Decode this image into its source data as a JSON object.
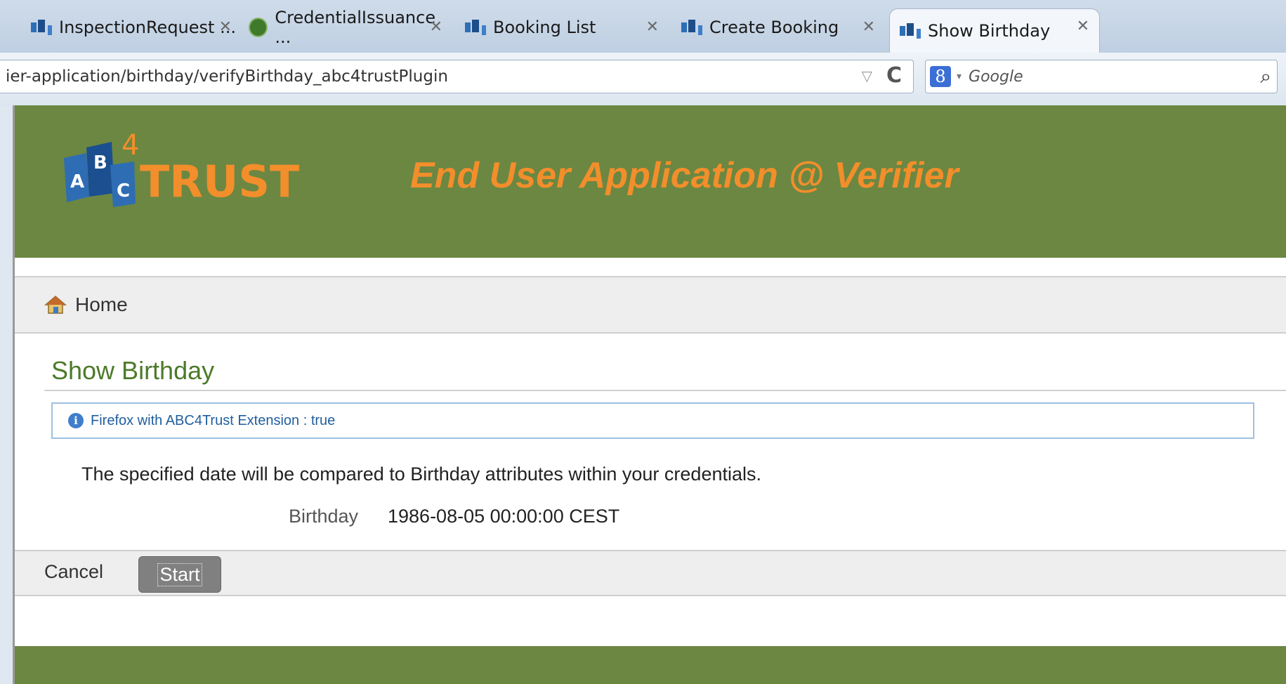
{
  "browser": {
    "tabs": [
      {
        "label": "InspectionRequest ...",
        "icon": "app-icon"
      },
      {
        "label": "CredentialIssuance ...",
        "icon": "green-app-icon"
      },
      {
        "label": "Booking List",
        "icon": "app-icon"
      },
      {
        "label": "Create Booking",
        "icon": "app-icon"
      },
      {
        "label": "Show Birthday",
        "icon": "app-icon",
        "active": true
      }
    ],
    "url": "ier-application/birthday/verifyBirthday_abc4trustPlugin",
    "search_placeholder": "Google",
    "search_engine_letter": "8"
  },
  "header": {
    "logo_text": {
      "a": "A",
      "b": "B",
      "c": "C",
      "four": "4",
      "trust": "TRUST"
    },
    "title": "End User Application @ Verifier",
    "bg_color": "#6b8742",
    "title_color": "#f28e2b"
  },
  "nav": {
    "home_label": "Home"
  },
  "main": {
    "page_title": "Show Birthday",
    "info_text": "Firefox with ABC4Trust Extension : true",
    "description": "The specified date will be compared to Birthday attributes within your credentials.",
    "field_label": "Birthday",
    "field_value": "1986-08-05 00:00:00 CEST"
  },
  "actions": {
    "cancel_label": "Cancel",
    "start_label": "Start"
  }
}
